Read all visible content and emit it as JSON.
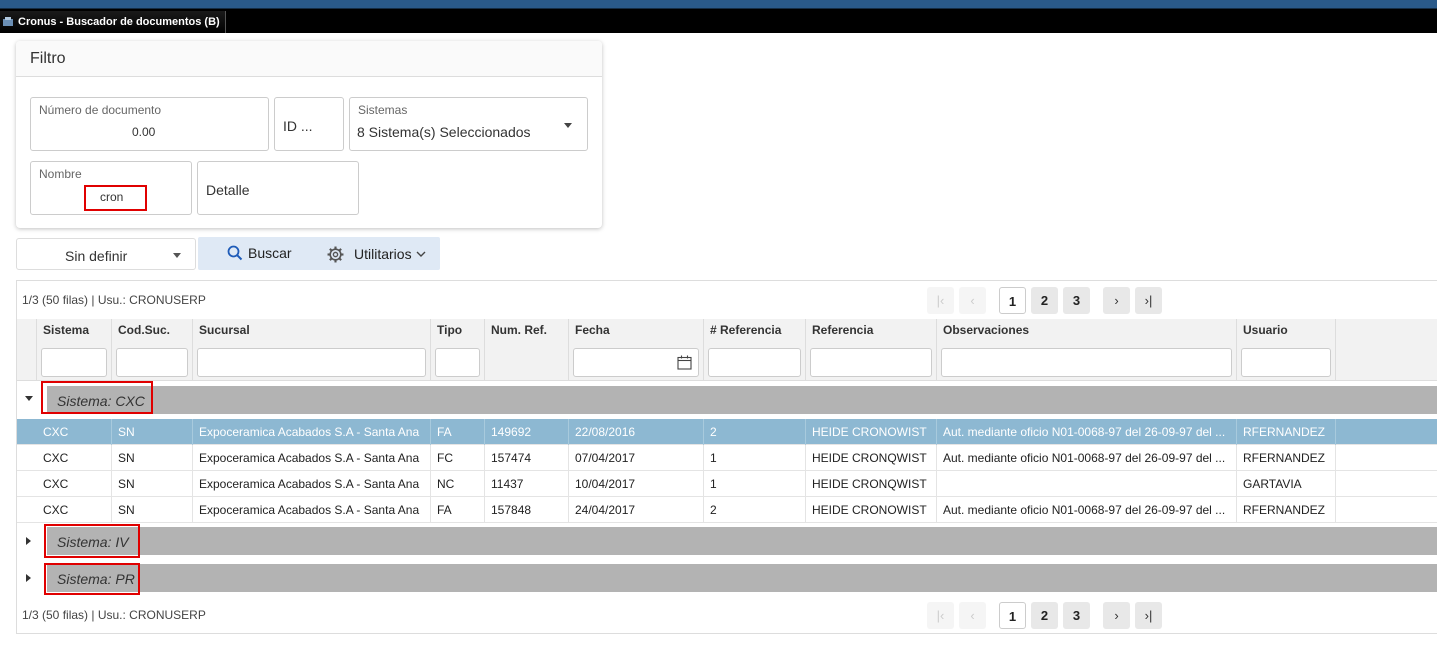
{
  "window": {
    "title": "Cronus - Buscador de documentos (B)"
  },
  "filter": {
    "title": "Filtro",
    "numero_documento": {
      "label": "Número de documento",
      "value": "0.00"
    },
    "id_field": {
      "value": "ID ..."
    },
    "sistemas": {
      "label": "Sistemas",
      "value": "8 Sistema(s) Seleccionados"
    },
    "nombre": {
      "label": "Nombre",
      "value": "cron"
    },
    "detalle": {
      "value": "Detalle"
    }
  },
  "toolbar": {
    "select_value": "Sin definir",
    "search_label": "Buscar",
    "utilities_label": "Utilitarios"
  },
  "pager": {
    "info": "1/3 (50 filas) | Usu.: CRONUSERP",
    "pages": [
      "1",
      "2",
      "3"
    ],
    "current_page": "1"
  },
  "columns": [
    "Sistema",
    "Cod.Suc.",
    "Sucursal",
    "Tipo",
    "Num. Ref.",
    "Fecha",
    "# Referencia",
    "Referencia",
    "Observaciones",
    "Usuario"
  ],
  "groups": [
    {
      "label": "Sistema: CXC",
      "expanded": true
    },
    {
      "label": "Sistema: IV",
      "expanded": false
    },
    {
      "label": "Sistema: PR",
      "expanded": false
    }
  ],
  "rows": [
    [
      "CXC",
      "SN",
      "Expoceramica Acabados S.A - Santa Ana",
      "FA",
      "149692",
      "22/08/2016",
      "2",
      "HEIDE CRONOWIST",
      "Aut. mediante oficio N01-0068-97 del 26-09-97 del ...",
      "RFERNANDEZ"
    ],
    [
      "CXC",
      "SN",
      "Expoceramica Acabados S.A - Santa Ana",
      "FC",
      "157474",
      "07/04/2017",
      "1",
      "HEIDE CRONQWIST",
      "Aut. mediante oficio N01-0068-97 del 26-09-97 del ...",
      "RFERNANDEZ"
    ],
    [
      "CXC",
      "SN",
      "Expoceramica Acabados S.A - Santa Ana",
      "NC",
      "11437",
      "10/04/2017",
      "1",
      "HEIDE CRONQWIST",
      "",
      "GARTAVIA"
    ],
    [
      "CXC",
      "SN",
      "Expoceramica Acabados S.A - Santa Ana",
      "FA",
      "157848",
      "24/04/2017",
      "2",
      "HEIDE CRONOWIST",
      "Aut. mediante oficio N01-0068-97 del 26-09-97 del ...",
      "RFERNANDEZ"
    ]
  ],
  "colors": {
    "selected_row": "#8db8d2",
    "group_bar": "#b3b3b3",
    "highlight": "#e00000",
    "toolbar_bg": "#dfe9f5"
  }
}
